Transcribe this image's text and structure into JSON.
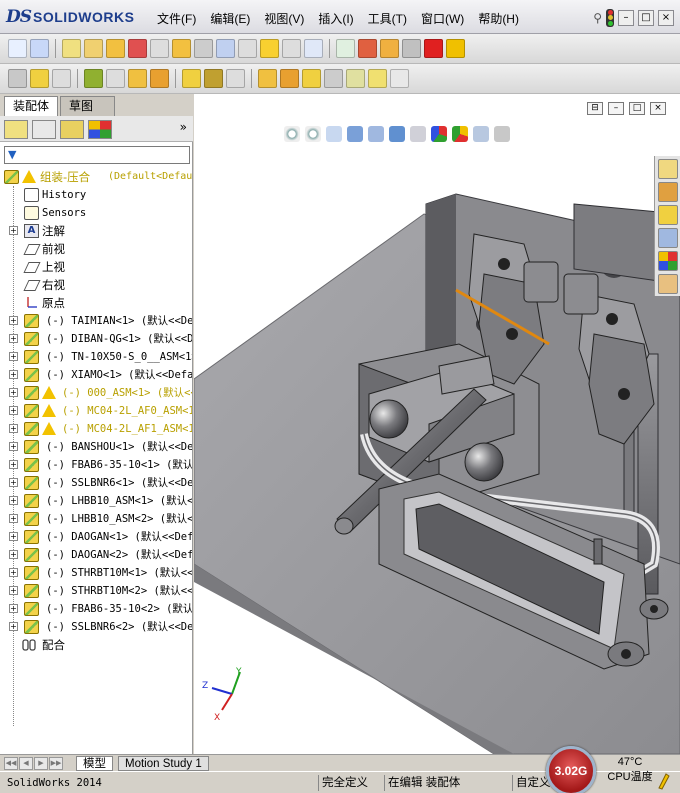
{
  "app": {
    "brand_ds": "DS",
    "brand_name": "SOLIDWORKS",
    "menu": [
      "文件(F)",
      "编辑(E)",
      "视图(V)",
      "插入(I)",
      "工具(T)",
      "窗口(W)",
      "帮助(H)"
    ],
    "window_controls": [
      "–",
      "□",
      "×"
    ]
  },
  "panel": {
    "tabs": [
      "装配体",
      "草图"
    ],
    "more_label": "»"
  },
  "tree": {
    "root": "组装-压合",
    "root_config": "(Default<Default",
    "items": [
      {
        "label": "History",
        "type": "history"
      },
      {
        "label": "Sensors",
        "type": "sensors"
      },
      {
        "label": "注解",
        "type": "note",
        "expand": "+"
      },
      {
        "label": "前视",
        "type": "plane"
      },
      {
        "label": "上视",
        "type": "plane"
      },
      {
        "label": "右视",
        "type": "plane"
      },
      {
        "label": "原点",
        "type": "origin"
      }
    ],
    "components": [
      {
        "label": "(-) TAIMIAN<1> (默认<<Def",
        "warn": false
      },
      {
        "label": "(-) DIBAN-QG<1> (默认<<Def",
        "warn": false
      },
      {
        "label": "(-) TN-10X50-S_0__ASM<1>",
        "warn": false
      },
      {
        "label": "(-) XIAMO<1> (默认<<Defau",
        "warn": false
      },
      {
        "label": "(-) 000_ASM<1> (默认<<D",
        "warn": true
      },
      {
        "label": "(-) MC04-2L_AF0_ASM<1>",
        "warn": true
      },
      {
        "label": "(-) MC04-2L_AF1_ASM<1>",
        "warn": true
      },
      {
        "label": "(-) BANSHOU<1> (默认<<Def",
        "warn": false
      },
      {
        "label": "(-) FBAB6-35-10<1> (默认<",
        "warn": false
      },
      {
        "label": "(-) SSLBNR6<1> (默认<<Def",
        "warn": false
      },
      {
        "label": "(-) LHBB10_ASM<1> (默认<<D",
        "warn": false
      },
      {
        "label": "(-) LHBB10_ASM<2> (默认<<D",
        "warn": false
      },
      {
        "label": "(-) DAOGAN<1> (默认<<Defa",
        "warn": false
      },
      {
        "label": "(-) DAOGAN<2> (默认<<Defa",
        "warn": false
      },
      {
        "label": "(-) STHRBT10M<1> (默认<<D",
        "warn": false
      },
      {
        "label": "(-) STHRBT10M<2> (默认<<D",
        "warn": false
      },
      {
        "label": "(-) FBAB6-35-10<2> (默认<",
        "warn": false
      },
      {
        "label": "(-) SSLBNR6<2> (默认<<Def",
        "warn": false
      }
    ],
    "mates": "配合"
  },
  "viewport": {
    "triad": {
      "x": "X",
      "y": "Y",
      "z": "Z"
    }
  },
  "bottom": {
    "tabs": [
      "模型",
      "Motion Study 1"
    ]
  },
  "status": {
    "app": "SolidWorks 2014",
    "defined": "完全定义",
    "editing": "在编辑 装配体",
    "custom": "自定义",
    "gauge": "3.02G",
    "temp": "47°C",
    "temp_label": "CPU温度"
  }
}
